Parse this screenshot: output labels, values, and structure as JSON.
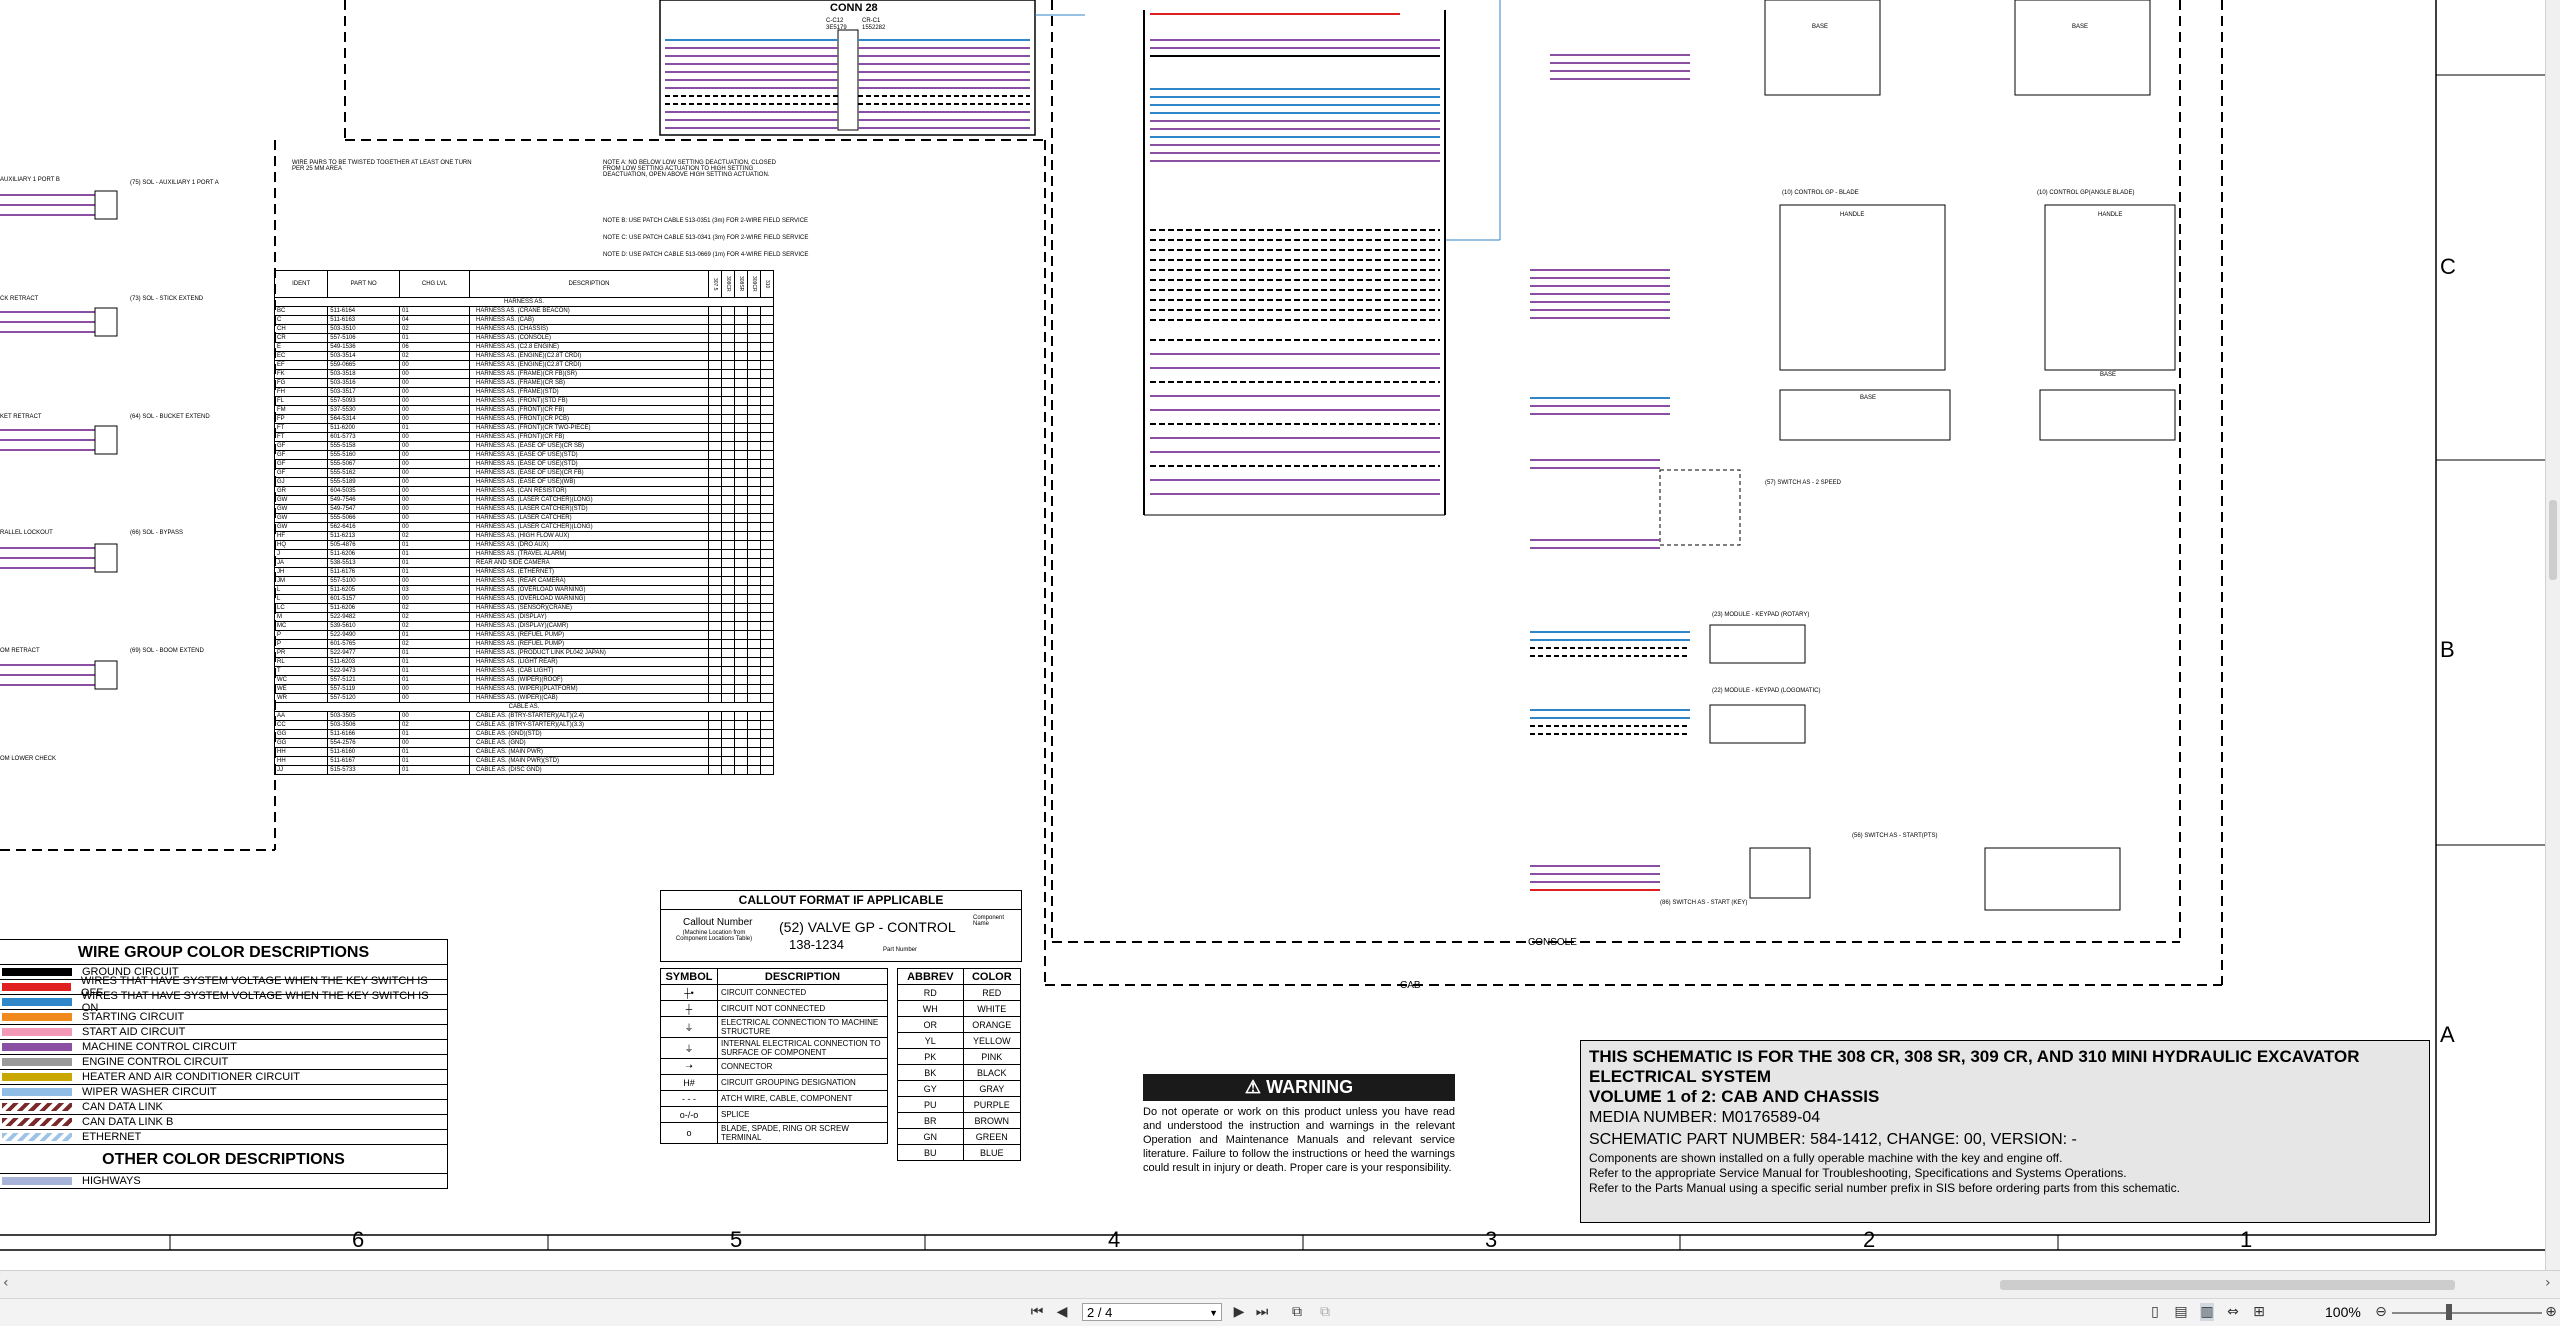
{
  "colors": {
    "black": "#000000",
    "red": "#e02020",
    "blue": "#2f86c8",
    "orange": "#f08a1c",
    "pink": "#f39ab8",
    "purple": "#8a4fa3",
    "gray": "#9a9a9a",
    "yellow": "#c8a800",
    "lightblue": "#8fbde6",
    "ethernet": "#9fc3e6",
    "highways": "#a7b3d9"
  },
  "conn28": {
    "title": "CONN 28",
    "left_id": "C-C12",
    "left_num": "3E5179",
    "right_id": "CR-C1",
    "right_num": "1552282"
  },
  "notes": {
    "wire_pairs_title": "WIRE PAIRS TO BE TWISTED TOGETHER AT LEAST ONE TURN PER 25 MM AREA",
    "note_a": "NOTE A: NO BELOW LOW SETTING DEACTUATION, CLOSED FROM LOW SETTING ACTUATION TO HIGH SETTING DEACTUATION, OPEN ABOVE HIGH SETTING ACTUATION.",
    "note_b": "NOTE B: USE PATCH CABLE 513-0351 (3m) FOR 2-WIRE FIELD SERVICE",
    "note_c": "NOTE C: USE PATCH CABLE 513-0341 (3m) FOR 2-WIRE FIELD SERVICE",
    "note_d": "NOTE D: USE PATCH CABLE 513-0669 (1m) FOR 4-WIRE FIELD SERVICE"
  },
  "harness_table": {
    "headers": [
      "IDENT",
      "PART NO",
      "CHG LVL",
      "DESCRIPTION",
      "307.5",
      "308CR",
      "308SR",
      "309CR",
      "310"
    ],
    "section1": "HARNESS AS.",
    "rows": [
      [
        "BC",
        "511-6164",
        "01",
        "HARNESS AS. (CRANE BEACON)"
      ],
      [
        "C",
        "511-6163",
        "04",
        "HARNESS AS. (CAB)"
      ],
      [
        "CH",
        "503-3510",
        "02",
        "HARNESS AS. (CHASSIS)"
      ],
      [
        "CR",
        "557-5106",
        "01",
        "HARNESS AS. (CONSOLE)"
      ],
      [
        "E",
        "549-1536",
        "06",
        "HARNESS AS. (C2.8 ENGINE)"
      ],
      [
        "EC",
        "503-3514",
        "02",
        "HARNESS AS. (ENGINE)(C2.8T CRDI)"
      ],
      [
        "EF",
        "559-0665",
        "00",
        "HARNESS AS. (ENGINE)(C2.8T CRDI)"
      ],
      [
        "FK",
        "503-3518",
        "00",
        "HARNESS AS. (FRAME)(CR FB)(SR)"
      ],
      [
        "FG",
        "503-3516",
        "00",
        "HARNESS AS. (FRAME)(CR SB)"
      ],
      [
        "FH",
        "503-3517",
        "00",
        "HARNESS AS. (FRAME)(STD)"
      ],
      [
        "FL",
        "557-5093",
        "00",
        "HARNESS AS. (FRONT)(STD FB)"
      ],
      [
        "FM",
        "537-5530",
        "00",
        "HARNESS AS. (FRONT)(CR FB)"
      ],
      [
        "FP",
        "564-5314",
        "00",
        "HARNESS AS. (FRONT)(CR PCB)"
      ],
      [
        "FT",
        "511-6200",
        "01",
        "HARNESS AS. (FRONT)(CR TWO-PIECE)"
      ],
      [
        "FT",
        "601-5773",
        "00",
        "HARNESS AS. (FRONT)(CR FB)"
      ],
      [
        "GF",
        "555-5158",
        "00",
        "HARNESS AS. (EASE OF USE)(CR SB)"
      ],
      [
        "GF",
        "555-5160",
        "00",
        "HARNESS AS. (EASE OF USE)(STD)"
      ],
      [
        "GF",
        "555-5067",
        "00",
        "HARNESS AS. (EASE OF USE)(STD)"
      ],
      [
        "GF",
        "555-5162",
        "00",
        "HARNESS AS. (EASE OF USE)(CR FB)"
      ],
      [
        "GJ",
        "555-5189",
        "00",
        "HARNESS AS. (EASE OF USE)(WB)"
      ],
      [
        "GR",
        "604-5035",
        "00",
        "HARNESS AS. (CAN RESISTOR)"
      ],
      [
        "GW",
        "549-7546",
        "00",
        "HARNESS AS. (LASER CATCHER)(LONG)"
      ],
      [
        "GW",
        "549-7547",
        "00",
        "HARNESS AS. (LASER CATCHER)(STD)"
      ],
      [
        "GW",
        "555-5066",
        "00",
        "HARNESS AS. (LASER CATCHER)"
      ],
      [
        "GW",
        "562-6416",
        "00",
        "HARNESS AS. (LASER CATCHER)(LONG)"
      ],
      [
        "HF",
        "511-6213",
        "02",
        "HARNESS AS. (HIGH FLOW AUX)"
      ],
      [
        "HQ",
        "505-4876",
        "01",
        "HARNESS AS. (DRO AUX)"
      ],
      [
        "J",
        "511-6206",
        "01",
        "HARNESS AS. (TRAVEL ALARM)"
      ],
      [
        "JA",
        "538-5513",
        "01",
        "REAR AND SIDE CAMERA"
      ],
      [
        "JH",
        "511-6176",
        "01",
        "HARNESS AS. (ETHERNET)"
      ],
      [
        "JM",
        "557-5100",
        "00",
        "HARNESS AS. (REAR CAMERA)"
      ],
      [
        "L",
        "511-6205",
        "03",
        "HARNESS AS. (OVERLOAD WARNING)"
      ],
      [
        "L",
        "601-5157",
        "00",
        "HARNESS AS. (OVERLOAD WARNING)"
      ],
      [
        "LC",
        "511-6206",
        "02",
        "HARNESS AS. (SENSOR)(CRANE)"
      ],
      [
        "M",
        "522-9482",
        "02",
        "HARNESS AS. (DISPLAY)"
      ],
      [
        "MC",
        "539-5610",
        "02",
        "HARNESS AS. (DISPLAY)(CAMR)"
      ],
      [
        "P",
        "522-9490",
        "01",
        "HARNESS AS. (REFUEL PUMP)"
      ],
      [
        "P",
        "601-5765",
        "02",
        "HARNESS AS. (REFUEL PUMP)"
      ],
      [
        "PR",
        "522-9477",
        "01",
        "HARNESS AS. (PRODUCT LINK PL042 JAPAN)"
      ],
      [
        "RL",
        "511-6203",
        "01",
        "HARNESS AS. (LIGHT REAR)"
      ],
      [
        "T",
        "522-9473",
        "01",
        "HARNESS AS. (CAB LIGHT)"
      ],
      [
        "WC",
        "557-5121",
        "01",
        "HARNESS AS. (WIPER)(ROOF)"
      ],
      [
        "WE",
        "557-5119",
        "00",
        "HARNESS AS. (WIPER)(PLATFORM)"
      ],
      [
        "WR",
        "557-5120",
        "00",
        "HARNESS AS. (WIPER)(CAB)"
      ]
    ],
    "section2": "CABLE AS.",
    "rows2": [
      [
        "AA",
        "503-3505",
        "00",
        "CABLE AS. (BTRY-STARTER)(ALT)(2.4)"
      ],
      [
        "CC",
        "503-3506",
        "02",
        "CABLE AS. (BTRY-STARTER)(ALT)(3.3)"
      ],
      [
        "GG",
        "511-6166",
        "01",
        "CABLE AS. (GND)(STD)"
      ],
      [
        "GG",
        "554-2576",
        "00",
        "CABLE AS. (GND)"
      ],
      [
        "HH",
        "511-6160",
        "01",
        "CABLE AS. (MAIN PWR)"
      ],
      [
        "HH",
        "511-6167",
        "01",
        "CABLE AS. (MAIN PWR)(STD)"
      ],
      [
        "JJ",
        "515-5733",
        "01",
        "CABLE AS. (DISC GND)"
      ]
    ]
  },
  "wire_group": {
    "title": "WIRE GROUP COLOR DESCRIPTIONS",
    "items": [
      {
        "label": "GROUND CIRCUIT",
        "color": "#000000",
        "style": "solid"
      },
      {
        "label": "WIRES THAT HAVE SYSTEM VOLTAGE WHEN THE KEY SWITCH IS OFF",
        "color": "#e02020",
        "style": "solid"
      },
      {
        "label": "WIRES THAT HAVE SYSTEM VOLTAGE WHEN THE KEY SWITCH IS ON",
        "color": "#2f86c8",
        "style": "solid"
      },
      {
        "label": "STARTING CIRCUIT",
        "color": "#f08a1c",
        "style": "solid"
      },
      {
        "label": "START AID CIRCUIT",
        "color": "#f39ab8",
        "style": "solid"
      },
      {
        "label": "MACHINE CONTROL CIRCUIT",
        "color": "#8a4fa3",
        "style": "solid"
      },
      {
        "label": "ENGINE CONTROL CIRCUIT",
        "color": "#9a9a9a",
        "style": "solid"
      },
      {
        "label": "HEATER AND AIR CONDITIONER CIRCUIT",
        "color": "#c8a800",
        "style": "solid"
      },
      {
        "label": "WIPER WASHER CIRCUIT",
        "color": "#8fbde6",
        "style": "solid"
      },
      {
        "label": "CAN DATA LINK",
        "color": "#7a2a2a",
        "style": "hatch"
      },
      {
        "label": "CAN DATA LINK B",
        "color": "#7a2a2a",
        "style": "hatch"
      },
      {
        "label": "ETHERNET",
        "color": "#9fc3e6",
        "style": "hatch"
      }
    ],
    "other_title": "OTHER COLOR DESCRIPTIONS",
    "other_items": [
      {
        "label": "HIGHWAYS",
        "color": "#a7b3d9"
      }
    ]
  },
  "callout": {
    "title": "CALLOUT FORMAT IF APPLICABLE",
    "callout_number": "Callout Number",
    "callout_note": "(Machine Location from Component Locations Table)",
    "example": "(52) VALVE GP - CONTROL",
    "part": "138-1234",
    "component_name": "Component Name",
    "part_number_label": "Part Number"
  },
  "symbols": {
    "headers": [
      "SYMBOL",
      "DESCRIPTION"
    ],
    "rows": [
      {
        "glyph": "┼•",
        "desc": "CIRCUIT CONNECTED"
      },
      {
        "glyph": "┼",
        "desc": "CIRCUIT NOT CONNECTED"
      },
      {
        "glyph": "⏚",
        "desc": "ELECTRICAL CONNECTION TO MACHINE STRUCTURE"
      },
      {
        "glyph": "⏚",
        "desc": "INTERNAL ELECTRICAL CONNECTION TO SURFACE OF COMPONENT"
      },
      {
        "glyph": "➝",
        "desc": "CONNECTOR"
      },
      {
        "glyph": "H#",
        "desc": "CIRCUIT GROUPING DESIGNATION"
      },
      {
        "glyph": "- - -",
        "desc": "ATCH WIRE, CABLE, COMPONENT"
      },
      {
        "glyph": "o-/-o",
        "desc": "SPLICE"
      },
      {
        "glyph": "o",
        "desc": "BLADE, SPADE, RING OR SCREW TERMINAL"
      }
    ]
  },
  "abbrev": {
    "headers": [
      "ABBREV",
      "COLOR"
    ],
    "rows": [
      [
        "RD",
        "RED"
      ],
      [
        "WH",
        "WHITE"
      ],
      [
        "OR",
        "ORANGE"
      ],
      [
        "YL",
        "YELLOW"
      ],
      [
        "PK",
        "PINK"
      ],
      [
        "BK",
        "BLACK"
      ],
      [
        "GY",
        "GRAY"
      ],
      [
        "PU",
        "PURPLE"
      ],
      [
        "BR",
        "BROWN"
      ],
      [
        "GN",
        "GREEN"
      ],
      [
        "BU",
        "BLUE"
      ]
    ]
  },
  "warning": {
    "title": "WARNING",
    "text": "Do not operate or work on this product unless you have read and understood the instruction and warnings in the relevant Operation and Maintenance Manuals and relevant service literature. Failure to follow the instructions or heed the warnings could result in injury or death. Proper care is your responsibility."
  },
  "title_block": {
    "line1": "THIS SCHEMATIC IS FOR THE 308 CR, 308 SR, 309 CR, AND 310 MINI HYDRAULIC EXCAVATOR",
    "line2": "ELECTRICAL SYSTEM",
    "line3": "VOLUME 1 of 2: CAB AND CHASSIS",
    "line4": "MEDIA NUMBER: M0176589-04",
    "line5": "SCHEMATIC PART NUMBER: 584-1412, CHANGE: 00, VERSION: -",
    "line6": "Components are shown installed on a fully operable machine with the key and engine off.",
    "line7": "Refer to the appropriate Service Manual for Troubleshooting, Specifications and Systems Operations.",
    "line8": "Refer to the Parts Manual using a specific serial number prefix in SIS before ordering parts from this schematic."
  },
  "labels": {
    "console": "CONSOLE",
    "cab": "CAB",
    "aux_port_b": "AUXILIARY 1 PORT B",
    "aux_port_a": "(75) SOL - AUXILIARY 1 PORT A",
    "stick_retract": "CK RETRACT",
    "stick_extend": "(73) SOL - STICK EXTEND",
    "bucket_retract": "KET RETRACT",
    "bucket_extend": "(64) SOL - BUCKET EXTEND",
    "parallel_lockout": "RALLEL LOCKOUT",
    "bypass": "(66) SOL - BYPASS",
    "boom_retract": "OM RETRACT",
    "boom_extend": "(69) SOL - BOOM EXTEND",
    "lower_check": "OM LOWER CHECK",
    "control_gp_blade_l": "(10) CONTROL GP - BLADE",
    "control_gp_blade_r": "(10) CONTROL GP(ANGLE BLADE)",
    "switch_2speed": "(57) SWITCH AS - 2 SPEED",
    "module_keypad_rot": "(23) MODULE - KEYPAD (ROTARY)",
    "module_keypad_log": "(22) MODULE - KEYPAD (LOGOMATIC)",
    "switch_start_pts": "(56) SWITCH AS - START(PTS)",
    "switch_start_key": "(86) SWITCH AS - START (KEY)",
    "handle": "HANDLE",
    "base": "BASE"
  },
  "zones": {
    "cols": [
      "6",
      "5",
      "4",
      "3",
      "2",
      "1"
    ],
    "rows": [
      "C",
      "B",
      "A"
    ]
  },
  "viewer": {
    "page_value": "2 / 4",
    "zoom": "100%"
  }
}
